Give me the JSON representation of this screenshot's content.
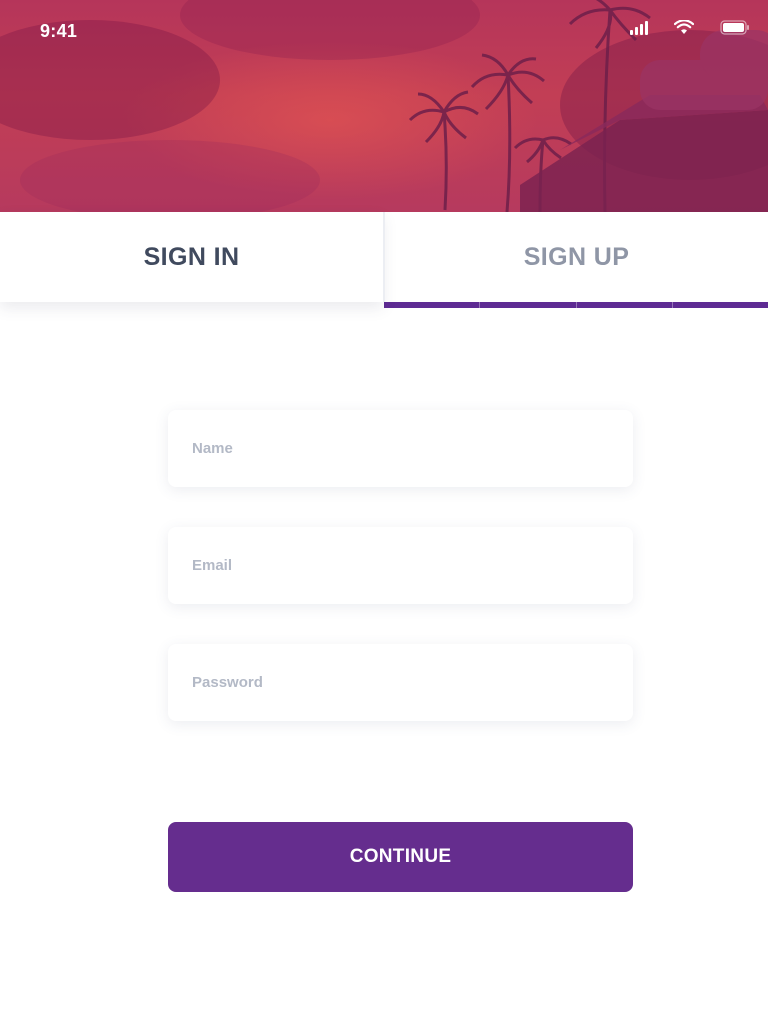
{
  "status_bar": {
    "time": "9:41",
    "icons": [
      "signal-icon",
      "wifi-icon",
      "battery-icon"
    ]
  },
  "hero": {
    "image": "tropical-sunset-photo",
    "overlay_color": "#b5355a"
  },
  "tabs": [
    {
      "label": "SIGN IN",
      "selected": false
    },
    {
      "label": "SIGN UP",
      "selected": true
    }
  ],
  "form": {
    "name_placeholder": "Name",
    "email_placeholder": "Email",
    "password_placeholder": "Password",
    "name_value": "",
    "email_value": "",
    "password_value": ""
  },
  "continue_label": "CONTINUE",
  "colors": {
    "accent": "#652d8e",
    "tab_active_text": "#404a5e",
    "tab_inactive_text": "#8f96a6",
    "placeholder": "#b3b9c6"
  }
}
